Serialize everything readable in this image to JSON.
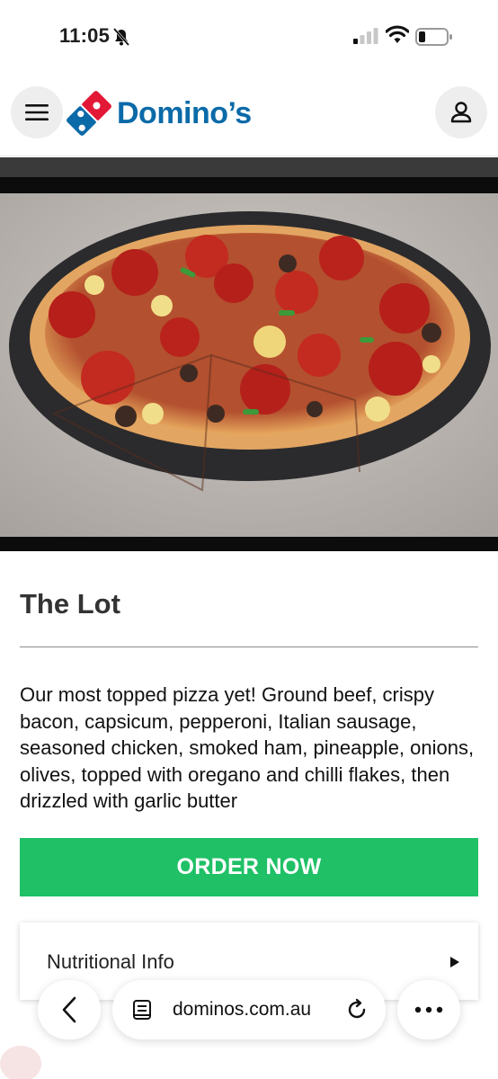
{
  "status_bar": {
    "time": "11:05",
    "icons": [
      "bell-slash-icon",
      "signal-icon",
      "wifi-icon",
      "battery-icon"
    ]
  },
  "header": {
    "brand": "Domino’s",
    "icons": [
      "hamburger-menu-icon",
      "dominos-logo-icon",
      "account-icon"
    ]
  },
  "product": {
    "title": "The Lot",
    "description": "Our most topped pizza yet! Ground beef, crispy bacon, capsicum, pepperoni, Italian sausage, seasoned chicken, smoked ham, pineapple, onions, olives, topped with oregano and chilli flakes, then drizzled with garlic butter",
    "order_label": "ORDER NOW",
    "nutrition_label": "Nutritional Info"
  },
  "browser": {
    "url": "dominos.com.au",
    "icons": [
      "back-icon",
      "page-icon",
      "reload-icon",
      "more-icon"
    ]
  },
  "colors": {
    "brand_blue": "#0b6aa8",
    "brand_red": "#e31837",
    "order_green": "#1fc066"
  }
}
